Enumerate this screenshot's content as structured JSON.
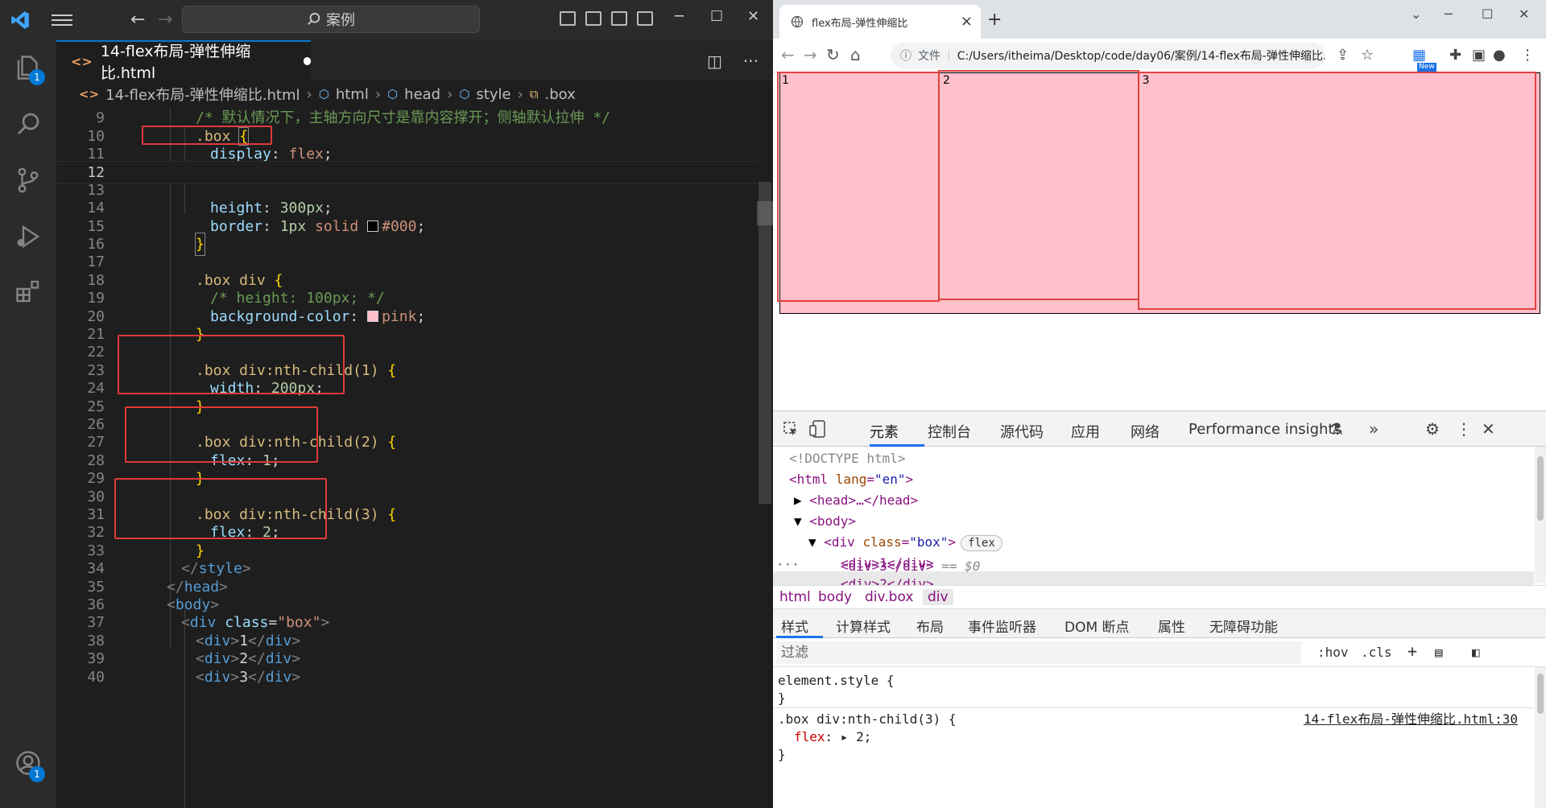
{
  "vscode": {
    "search_text": "案例",
    "tab_title": "14-flex布局-弹性伸缩比.html",
    "breadcrumbs": [
      "14-flex布局-弹性伸缩比.html",
      "html",
      "head",
      "style",
      ".box"
    ],
    "badges": {
      "explorer": "1",
      "accounts": "1"
    },
    "lines": [
      {
        "n": "9",
        "text": "/* 默认情况下，主轴方向尺寸是靠内容撑开；侧轴默认拉伸 */"
      },
      {
        "n": "10",
        "sel": ".box ",
        "brace": "{"
      },
      {
        "n": "11",
        "prop": "display",
        "val": "flex"
      },
      {
        "n": "12"
      },
      {
        "n": "13"
      },
      {
        "n": "14",
        "prop": "height",
        "num": "300px"
      },
      {
        "n": "15",
        "prop": "border",
        "num": "1px",
        "val2": "solid",
        "color": "#000"
      },
      {
        "n": "16",
        "brace": "}"
      },
      {
        "n": "17"
      },
      {
        "n": "18",
        "sel": ".box div ",
        "brace": "{"
      },
      {
        "n": "19",
        "text": "/* height: 100px; */"
      },
      {
        "n": "20",
        "prop": "background-color",
        "color": "pink"
      },
      {
        "n": "21",
        "brace": "}"
      },
      {
        "n": "22"
      },
      {
        "n": "23",
        "sel": ".box div:nth-child(1) ",
        "brace": "{"
      },
      {
        "n": "24",
        "prop": "width",
        "num": "200px"
      },
      {
        "n": "25",
        "brace": "}"
      },
      {
        "n": "26"
      },
      {
        "n": "27",
        "sel": ".box div:nth-child(2) ",
        "brace": "{"
      },
      {
        "n": "28",
        "prop": "flex",
        "num": "1"
      },
      {
        "n": "29",
        "brace": "}"
      },
      {
        "n": "30"
      },
      {
        "n": "31",
        "sel": ".box div:nth-child(3) ",
        "brace": "{"
      },
      {
        "n": "32",
        "prop": "flex",
        "num": "2"
      },
      {
        "n": "33",
        "brace": "}"
      },
      {
        "n": "34",
        "close": "style"
      },
      {
        "n": "35",
        "close": "head"
      },
      {
        "n": "36",
        "open": "body"
      },
      {
        "n": "37",
        "open": "div",
        "attr": "class",
        "attrval": "\"box\""
      },
      {
        "n": "38",
        "inner": "1"
      },
      {
        "n": "39",
        "inner": "2"
      },
      {
        "n": "40",
        "inner": "3"
      }
    ]
  },
  "chrome": {
    "tab_title": "flex布局-弹性伸缩比",
    "url_prefix": "文件",
    "url": "C:/Users/itheima/Desktop/code/day06/案例/14-flex布局-弹性伸缩比.html",
    "new_badge": "New",
    "items": [
      {
        "label": "1",
        "flex": 200
      },
      {
        "label": "2",
        "flex": 1
      },
      {
        "label": "3",
        "flex": 2
      }
    ],
    "devtools": {
      "tabs": [
        "元素",
        "控制台",
        "源代码",
        "应用",
        "网络",
        "Performance insights"
      ],
      "dom": {
        "doctype": "<!DOCTYPE html>",
        "html_open": "<html ",
        "lang_attr": "lang",
        "lang_val": "\"en\"",
        "head": "<head>…</head>",
        "body": "<body>",
        "div_box_open": "<div ",
        "class_attr": "class",
        "class_val": "\"box\"",
        "flex_pill": "flex",
        "child1": "<div>1</div>",
        "child2": "<div>2</div>",
        "child3": "<div>3</div>",
        "child3_suffix": " == $0"
      },
      "crumbs": [
        "html",
        "body",
        "div.box",
        "div"
      ],
      "style_tabs": [
        "样式",
        "计算样式",
        "布局",
        "事件监听器",
        "DOM 断点",
        "属性",
        "无障碍功能"
      ],
      "filter_placeholder": "过滤",
      "filter_buttons": [
        ":hov",
        ".cls",
        "+"
      ],
      "element_style": "element.style {",
      "close_brace": "}",
      "rule_selector": ".box div:nth-child(3) {",
      "rule_source": "14-flex布局-弹性伸缩比.html:30",
      "rule_prop": "flex",
      "rule_value": "2;"
    }
  }
}
